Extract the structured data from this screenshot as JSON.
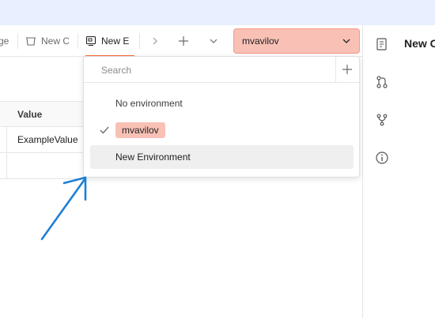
{
  "tabs": [
    {
      "label": "ge"
    },
    {
      "label": "New C"
    },
    {
      "label": "New E"
    }
  ],
  "tab_controls": {
    "next": "chevron-right-icon",
    "add": "plus-icon",
    "more": "chevron-down-icon"
  },
  "environment_selector": {
    "value": "mvavilov"
  },
  "right_panel": {
    "title": "New C"
  },
  "table": {
    "header": "Value",
    "rows": [
      "ExampleValue",
      ""
    ]
  },
  "dropdown": {
    "search_placeholder": "Search",
    "items": [
      {
        "label": "No environment",
        "selected": false
      },
      {
        "label": "mvavilov",
        "selected": true
      },
      {
        "label": "New Environment",
        "selected": false
      }
    ]
  },
  "colors": {
    "accent": "#ff6c37",
    "selected_env_bg": "#f9c1b6",
    "annotation_arrow": "#1e7fd4",
    "topbar": "#e8f0ff"
  }
}
